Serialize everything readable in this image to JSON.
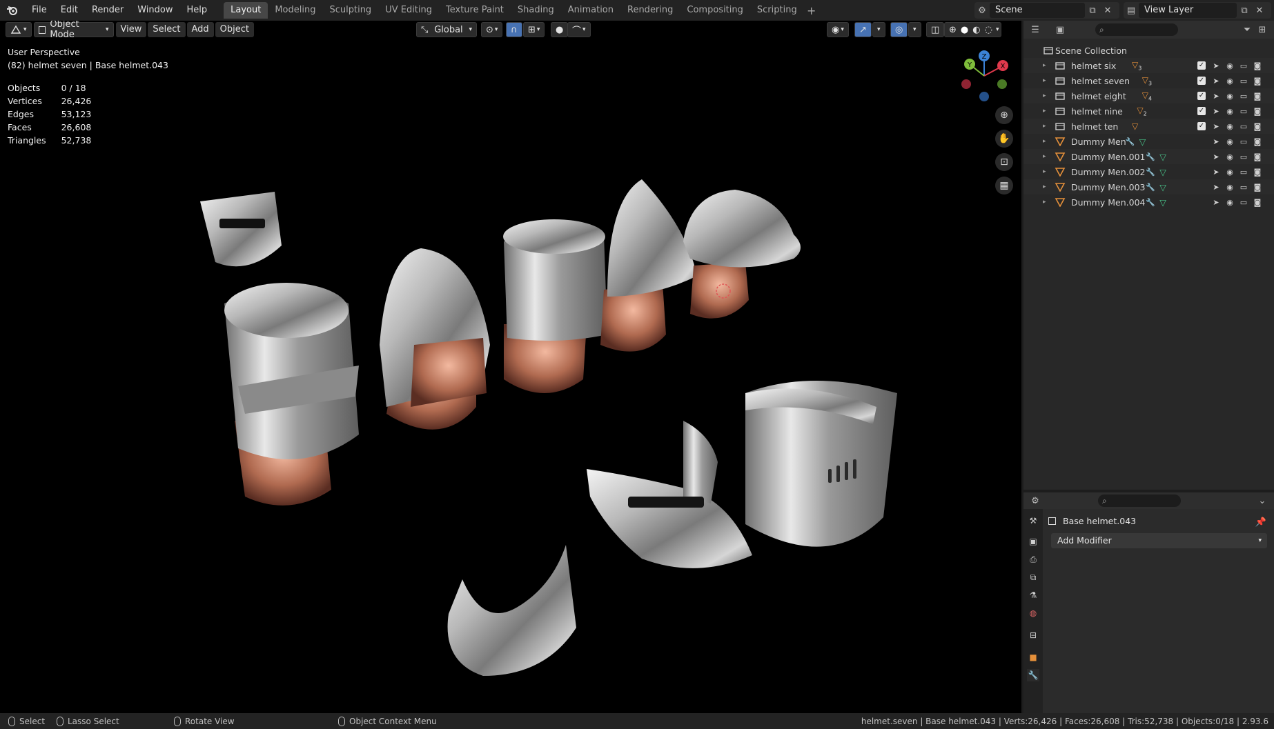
{
  "menu": {
    "items": [
      "File",
      "Edit",
      "Render",
      "Window",
      "Help"
    ]
  },
  "workspaces": [
    "Layout",
    "Modeling",
    "Sculpting",
    "UV Editing",
    "Texture Paint",
    "Shading",
    "Animation",
    "Rendering",
    "Compositing",
    "Scripting"
  ],
  "workspace_add": "+",
  "scene": {
    "name": "Scene",
    "view_layer": "View Layer"
  },
  "viewport_header": {
    "mode": "Object Mode",
    "view": "View",
    "select": "Select",
    "add": "Add",
    "object": "Object",
    "transform_orientation": "Global"
  },
  "overlay": {
    "perspective": "User Perspective",
    "active": "(82) helmet seven | Base helmet.043"
  },
  "stats": [
    {
      "label": "Objects",
      "value": "0 / 18"
    },
    {
      "label": "Vertices",
      "value": "26,426"
    },
    {
      "label": "Edges",
      "value": "53,123"
    },
    {
      "label": "Faces",
      "value": "26,608"
    },
    {
      "label": "Triangles",
      "value": "52,738"
    }
  ],
  "gizmo": {
    "x": "X",
    "y": "Y",
    "z": "Z"
  },
  "outliner": {
    "root": "Scene Collection",
    "rows": [
      {
        "name": "helmet six",
        "kind": "collection",
        "badge": "3",
        "checkbox": true
      },
      {
        "name": "helmet seven",
        "kind": "collection",
        "badge": "3",
        "checkbox": true
      },
      {
        "name": "helmet eight",
        "kind": "collection",
        "badge": "4",
        "checkbox": true
      },
      {
        "name": "helmet nine",
        "kind": "collection",
        "badge": "2",
        "checkbox": true
      },
      {
        "name": "helmet ten",
        "kind": "collection",
        "badge": "",
        "checkbox": true
      },
      {
        "name": "Dummy Men",
        "kind": "mesh",
        "badge": "",
        "checkbox": false
      },
      {
        "name": "Dummy Men.001",
        "kind": "mesh",
        "badge": "",
        "checkbox": false
      },
      {
        "name": "Dummy Men.002",
        "kind": "mesh",
        "badge": "",
        "checkbox": false
      },
      {
        "name": "Dummy Men.003",
        "kind": "mesh",
        "badge": "",
        "checkbox": false
      },
      {
        "name": "Dummy Men.004",
        "kind": "mesh",
        "badge": "",
        "checkbox": false
      }
    ]
  },
  "properties": {
    "object_name": "Base helmet.043",
    "add_modifier": "Add Modifier"
  },
  "statusbar": {
    "select": "Select",
    "lasso": "Lasso Select",
    "rotate": "Rotate View",
    "context": "Object Context Menu",
    "right": "helmet.seven | Base helmet.043 | Verts:26,426 | Faces:26,608 | Tris:52,738 | Objects:0/18 | 2.93.6"
  },
  "colors": {
    "accent": "#4772b3",
    "mesh_orange": "#e5903a",
    "mesh_green": "#49c48a",
    "x_axis": "#e0394c",
    "y_axis": "#7fbd3b",
    "z_axis": "#3b82d6"
  }
}
